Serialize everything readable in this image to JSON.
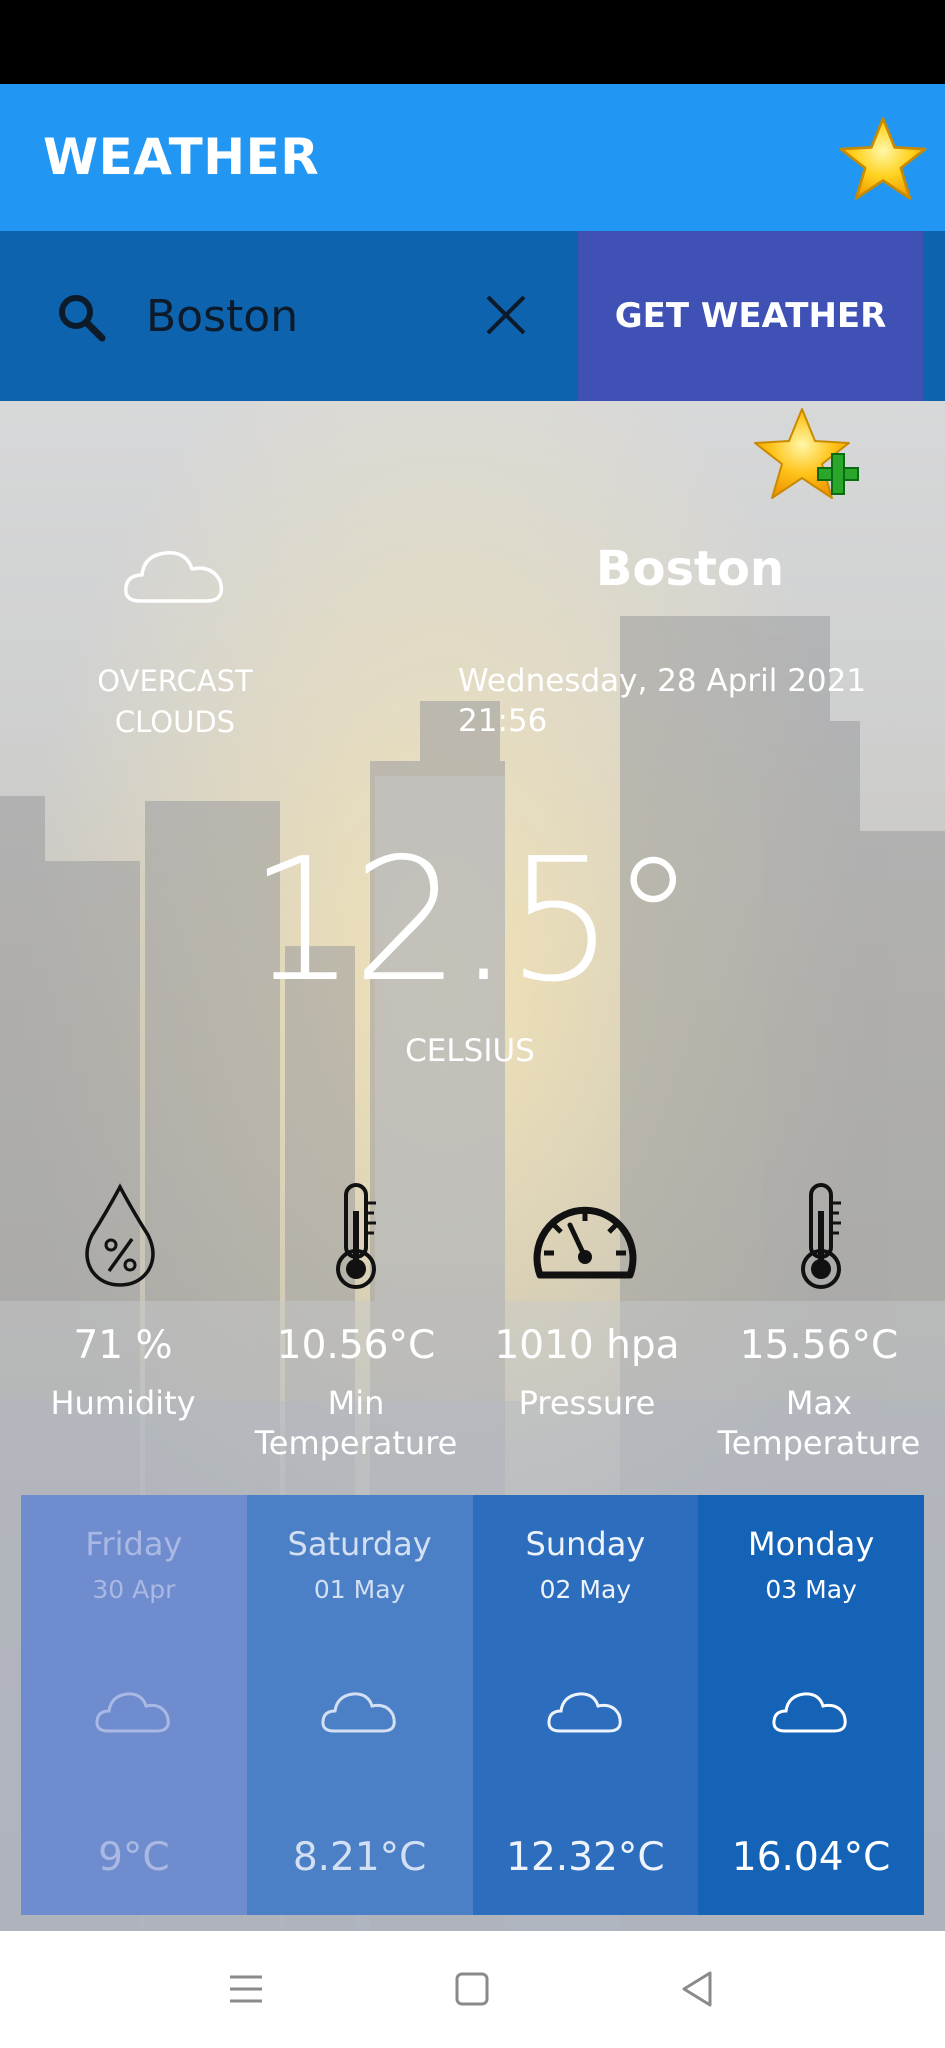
{
  "app": {
    "title": "WEATHER"
  },
  "search": {
    "value": "Boston",
    "button_label": "GET WEATHER"
  },
  "current": {
    "city": "Boston",
    "condition_line1": "OVERCAST",
    "condition_line2": "CLOUDS",
    "date": "Wednesday, 28 April 2021",
    "time": "21:56",
    "temperature": "12.5°",
    "unit": "CELSIUS"
  },
  "stats": {
    "humidity": {
      "value": "71 %",
      "label": "Humidity"
    },
    "min_temp": {
      "value": "10.56°C",
      "label_line1": "Min",
      "label_line2": "Temperature"
    },
    "pressure": {
      "value": "1010 hpa",
      "label": "Pressure"
    },
    "max_temp": {
      "value": "15.56°C",
      "label_line1": "Max",
      "label_line2": "Temperature"
    }
  },
  "forecast": [
    {
      "day": "Friday",
      "date": "30 Apr",
      "temp": "9°C",
      "bg": "#6f8ccf",
      "text": "#a9b9e3"
    },
    {
      "day": "Saturday",
      "date": "01 May",
      "temp": "8.21°C",
      "bg": "#4b7fc6",
      "text": "#d3dff2"
    },
    {
      "day": "Sunday",
      "date": "02 May",
      "temp": "12.32°C",
      "bg": "#2c6ebd",
      "text": "#eef3fb"
    },
    {
      "day": "Monday",
      "date": "03 May",
      "temp": "16.04°C",
      "bg": "#1463b7",
      "text": "#ffffff"
    }
  ],
  "colors": {
    "app_bar": "#2196f3",
    "search_row": "#0d63ad",
    "button": "#3f51b5"
  },
  "icons": {
    "favorites": "star-icon",
    "add_favorite": "star-plus-icon",
    "search": "search-icon",
    "clear": "close-icon",
    "condition": "cloud-icon",
    "humidity": "humidity-drop-icon",
    "thermometer": "thermometer-icon",
    "pressure": "gauge-icon"
  }
}
